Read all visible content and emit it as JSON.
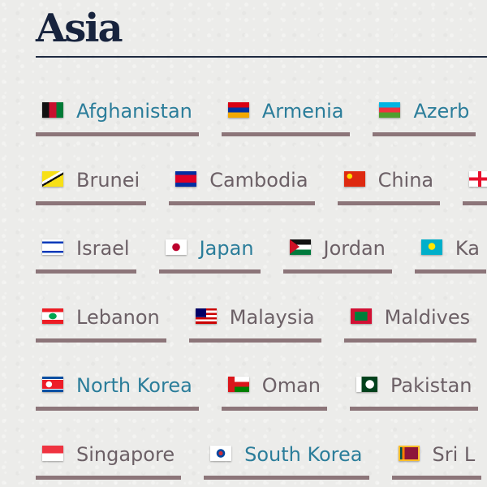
{
  "page": {
    "title": "Asia"
  },
  "rows": [
    [
      {
        "name": "Afghanistan",
        "flag": "flag-afghanistan",
        "visited": true
      },
      {
        "name": "Armenia",
        "flag": "flag-armenia",
        "visited": true
      },
      {
        "name": "Azerb",
        "flag": "flag-azerbaijan",
        "visited": true
      }
    ],
    [
      {
        "name": "Brunei",
        "flag": "flag-brunei",
        "visited": false
      },
      {
        "name": "Cambodia",
        "flag": "flag-cambodia",
        "visited": false
      },
      {
        "name": "China",
        "flag": "flag-china",
        "visited": false
      },
      {
        "name": "",
        "flag": "flag-georgia",
        "visited": false
      }
    ],
    [
      {
        "name": "Israel",
        "flag": "flag-israel",
        "visited": false
      },
      {
        "name": "Japan",
        "flag": "flag-japan",
        "visited": true
      },
      {
        "name": "Jordan",
        "flag": "flag-jordan",
        "visited": false
      },
      {
        "name": "Ka",
        "flag": "flag-kazakhstan",
        "visited": false
      }
    ],
    [
      {
        "name": "Lebanon",
        "flag": "flag-lebanon",
        "visited": false
      },
      {
        "name": "Malaysia",
        "flag": "flag-malaysia",
        "visited": false
      },
      {
        "name": "Maldives",
        "flag": "flag-maldives",
        "visited": false
      }
    ],
    [
      {
        "name": "North Korea",
        "flag": "flag-north-korea",
        "visited": true
      },
      {
        "name": "Oman",
        "flag": "flag-oman",
        "visited": false
      },
      {
        "name": "Pakistan",
        "flag": "flag-pakistan",
        "visited": false
      }
    ],
    [
      {
        "name": "Singapore",
        "flag": "flag-singapore",
        "visited": false
      },
      {
        "name": "South Korea",
        "flag": "flag-south-korea",
        "visited": true
      },
      {
        "name": "Sri L",
        "flag": "flag-sri-lanka",
        "visited": false
      }
    ]
  ],
  "colors": {
    "title": "#17233d",
    "link_visited": "#2b7d9a",
    "link_default": "#6c6066",
    "underline": "#8c7579",
    "background": "#ececea"
  }
}
